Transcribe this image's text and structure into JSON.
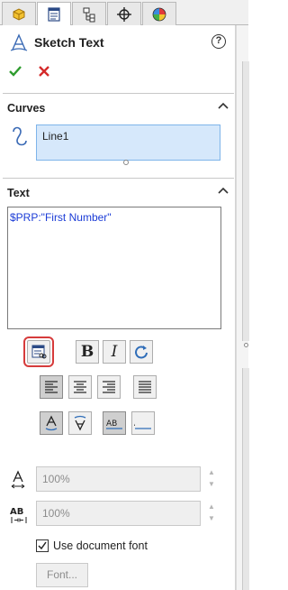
{
  "tabs": [
    {
      "icon": "feature-manager-icon",
      "active": false
    },
    {
      "icon": "property-manager-icon",
      "active": true
    },
    {
      "icon": "configuration-manager-icon",
      "active": false
    },
    {
      "icon": "dimxpert-manager-icon",
      "active": false
    },
    {
      "icon": "display-manager-icon",
      "active": false
    }
  ],
  "header": {
    "title": "Sketch Text",
    "title_icon": "sketch-text-icon",
    "help": "?"
  },
  "actions": {
    "ok_icon": "checkmark-icon",
    "cancel_icon": "close-icon",
    "ok_color": "#2e9c2e",
    "cancel_color": "#d42a2a"
  },
  "curves": {
    "heading": "Curves",
    "selection": "Line1"
  },
  "text": {
    "heading": "Text",
    "value": "$PRP:\"First Number\"",
    "value_color": "#1a3bd6"
  },
  "formatting": {
    "link_property_button": "link-to-property-icon",
    "bold": "B",
    "italic": "I",
    "rotate_icon": "rotate-icon",
    "alignment": [
      "align-left-icon",
      "align-center-icon",
      "align-right-icon",
      "justify-icon"
    ],
    "alignment_pressed": "align-left-icon",
    "flip": [
      "flip-vertical-icon",
      "flip-vertical-inverse-icon",
      "flip-horizontal-icon",
      "flip-horizontal-inverse-icon"
    ],
    "highlight_color": "#d63b3b"
  },
  "width_factor": {
    "icon": "width-factor-icon",
    "value": "100%"
  },
  "spacing": {
    "icon": "spacing-icon",
    "value": "100%"
  },
  "use_document_font": {
    "label": "Use document font",
    "checked": true
  },
  "font_button": {
    "label": "Font..."
  }
}
